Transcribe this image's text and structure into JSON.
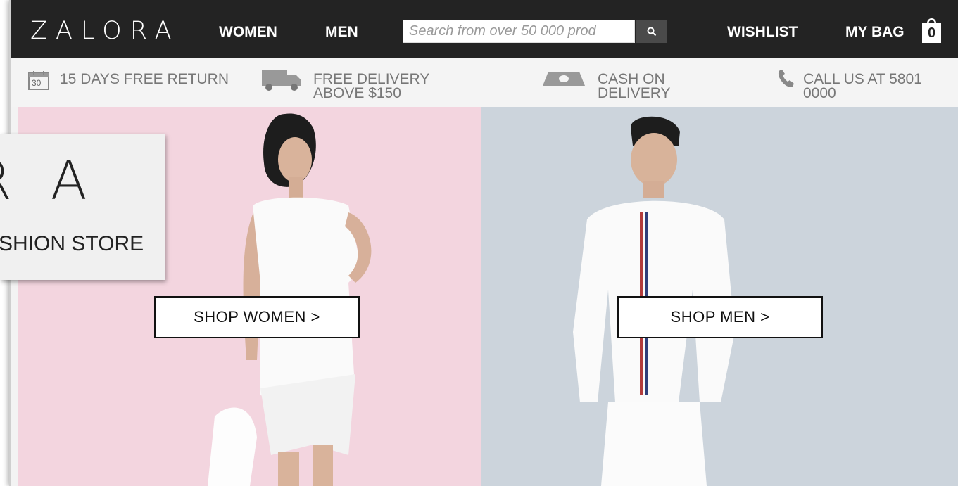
{
  "header": {
    "logo": "ZALORA",
    "nav": [
      "WOMEN",
      "MEN"
    ],
    "search_placeholder": "Search from over 50 000 prod",
    "wishlist": "WISHLIST",
    "bag_label": "MY BAG",
    "bag_count": "0"
  },
  "infobar": {
    "return": {
      "icon": "calendar-icon",
      "day": "30",
      "text": "15 DAYS FREE RETURN"
    },
    "delivery": {
      "icon": "truck-icon",
      "line1": "FREE DELIVERY",
      "line2": "ABOVE $150"
    },
    "cash": {
      "icon": "cash-icon",
      "line1": "CASH ON",
      "line2": "DELIVERY"
    },
    "call": {
      "icon": "phone-icon",
      "line1": "CALL US AT 5801",
      "line2": "0000"
    }
  },
  "banners": {
    "women_cta": "SHOP WOMEN >",
    "men_cta": "SHOP  MEN >"
  },
  "brand_overlay": {
    "letters": "RA",
    "subtitle": "ASHION STORE"
  },
  "colors": {
    "nav_bg": "#232323",
    "women_bg": "#f3d5df",
    "men_bg": "#ccd4dc"
  }
}
